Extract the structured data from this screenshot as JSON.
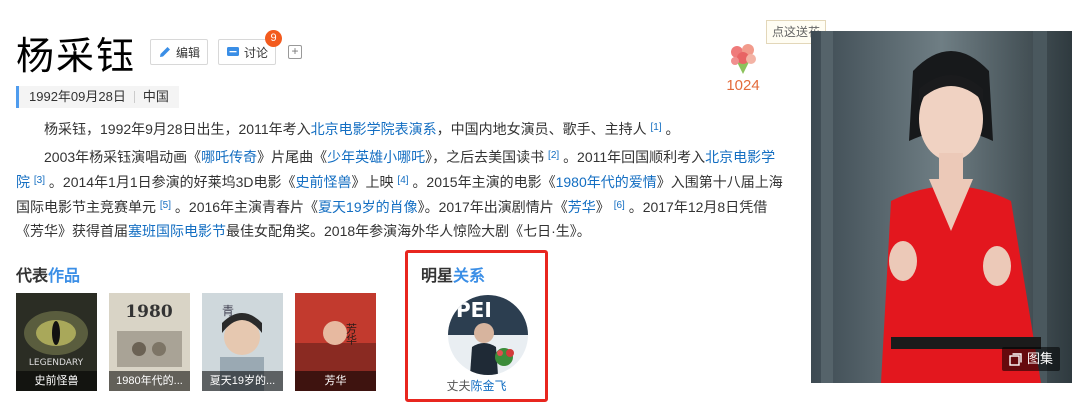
{
  "header": {
    "title": "杨采钰",
    "edit_label": "编辑",
    "discuss_label": "讨论",
    "discuss_count": "9",
    "plus": "+"
  },
  "flower": {
    "tip": "点这送花",
    "count": "1024"
  },
  "info": {
    "birthday": "1992年09月28日",
    "country": "中国"
  },
  "intro": {
    "p1_a": "杨采钰，1992年9月28日出生，2011年考入",
    "p1_link": "北京电影学院表演系",
    "p1_b": "，中国内地女演员、歌手、主持人",
    "p1_ref": "[1]",
    "p1_c": "。",
    "p2": {
      "t1": "2003年杨采钰演唱动画《",
      "l1": "哪吒传奇",
      "t2": "》片尾曲《",
      "l2": "少年英雄小哪吒",
      "t3": "》，之后去美国读书",
      "r2": "[2]",
      "t4": "。2011年回国顺利考入",
      "l3": "北京电影学院",
      "r3": "[3]",
      "t5": "。2014年1月1日参演的好莱坞3D电影《",
      "l4": "史前怪兽",
      "t6": "》上映",
      "r4": "[4]",
      "t7": "。2015年主演的电影《",
      "l5": "1980年代的爱情",
      "t8": "》入围第十八届上海国际电影节主竞赛单元",
      "r5": "[5]",
      "t9": "。2016年主演青春片《",
      "l6": "夏天19岁的肖像",
      "t10": "》。2017年出演剧情片《",
      "l7": "芳华",
      "t11": "》",
      "r6": "[6]",
      "t12": "。2017年12月8日凭借《芳华》获得首届",
      "l8": "塞班国际电影节",
      "t13": "最佳女配角奖。2018年参演海外华人惊险大剧《七日·生》。"
    }
  },
  "works": {
    "title_a": "代表",
    "title_b": "作品",
    "items": [
      {
        "caption": "史前怪兽",
        "poster_text": "LEGENDARY"
      },
      {
        "caption": "1980年代的...",
        "poster_text": "1980"
      },
      {
        "caption": "夏天19岁的...",
        "poster_text": "青"
      },
      {
        "caption": "芳华",
        "poster_text": "芳华"
      }
    ]
  },
  "relations": {
    "title_a": "明星",
    "title_b": "关系",
    "role": "丈夫",
    "name": "陈金飞"
  },
  "photo": {
    "gallery_label": "图集"
  }
}
